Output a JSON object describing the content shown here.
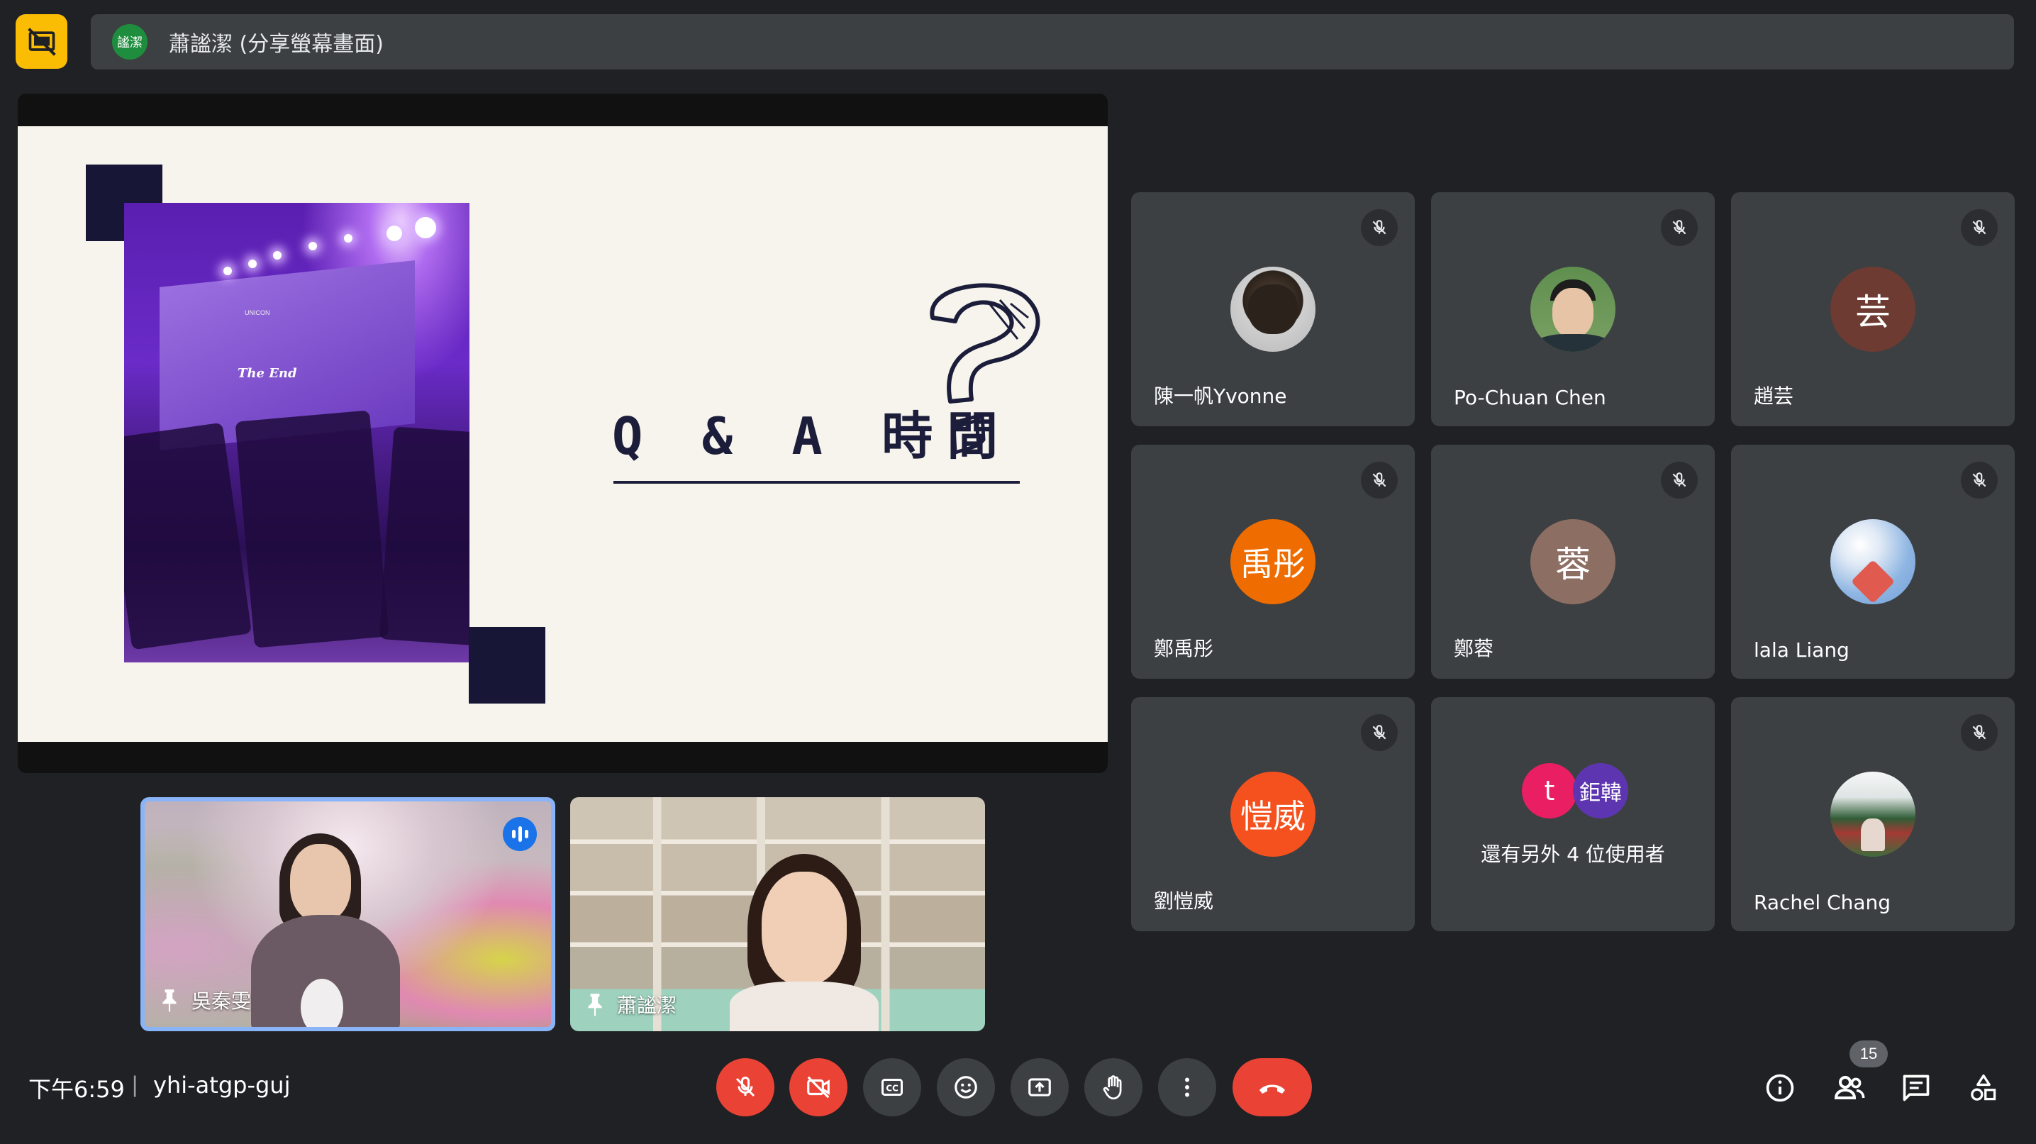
{
  "top_bar": {
    "presenter_chip_text": "謐潔",
    "presenting_label": "蕭謐潔 (分享螢幕畫面)"
  },
  "slide": {
    "title": "Q & A 時間",
    "photo_text_end": "The End",
    "photo_text_brand": "UNICON"
  },
  "pinned": [
    {
      "name": "吳秦雯",
      "speaking": true
    },
    {
      "name": "蕭謐潔",
      "speaking": false
    }
  ],
  "participants": [
    {
      "name": "陳一帆Yvonne",
      "avatar_type": "photo",
      "avatar_desc": "dog",
      "muted": true
    },
    {
      "name": "Po-Chuan Chen",
      "avatar_type": "photo",
      "avatar_desc": "person",
      "muted": true
    },
    {
      "name": "趙芸",
      "avatar_type": "initial",
      "initial": "芸",
      "color": "#6d3b32",
      "muted": true
    },
    {
      "name": "鄭禹彤",
      "avatar_type": "initial",
      "initial": "禹彤",
      "color": "#ef6c00",
      "muted": true
    },
    {
      "name": "鄭蓉",
      "avatar_type": "initial",
      "initial": "蓉",
      "color": "#8d6e63",
      "muted": true
    },
    {
      "name": "lala Liang",
      "avatar_type": "photo",
      "avatar_desc": "sky",
      "muted": true
    },
    {
      "name": "劉愷威",
      "avatar_type": "initial",
      "initial": "愷威",
      "color": "#f4511e",
      "muted": true
    },
    {
      "name": "還有另外 4 位使用者",
      "avatar_type": "group",
      "initials": [
        "t",
        "鉅韓"
      ],
      "colors": [
        "#e91e63",
        "#5e35b1"
      ],
      "muted": false
    },
    {
      "name": "Rachel Chang",
      "avatar_type": "photo",
      "avatar_desc": "garden",
      "muted": true
    }
  ],
  "meeting": {
    "time": "下午6:59",
    "separator": "|",
    "code": "yhi-atgp-guj"
  },
  "controls": {
    "mic_icon": "mic-off-icon",
    "camera_icon": "videocam-off-icon",
    "captions_icon": "closed-caption-icon",
    "emoji_icon": "emoji-icon",
    "present_icon": "present-screen-icon",
    "raise_hand_icon": "raise-hand-icon",
    "more_icon": "more-vert-icon",
    "leave_icon": "call-end-icon"
  },
  "right_controls": {
    "people_count": "15"
  },
  "colors": {
    "background": "#202124",
    "tile": "#3c4043",
    "accent_red": "#ea4335",
    "accent_yellow": "#fbbc04",
    "active_speaker": "#8ab4f8"
  }
}
